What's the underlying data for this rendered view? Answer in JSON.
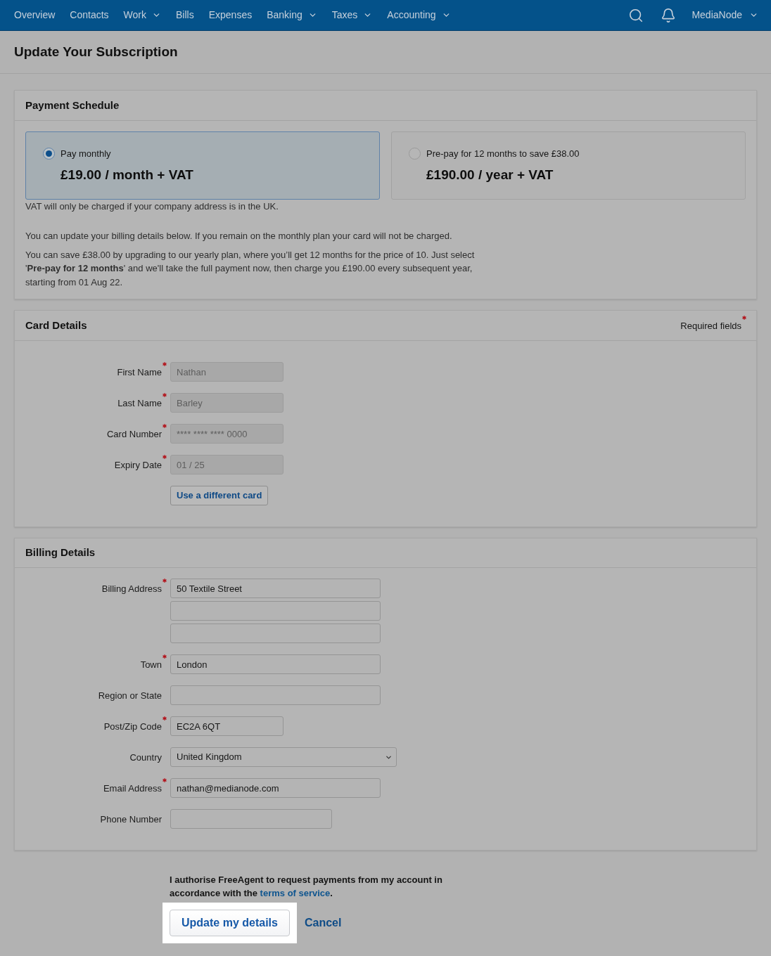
{
  "nav": {
    "items": [
      {
        "label": "Overview",
        "has_menu": false
      },
      {
        "label": "Contacts",
        "has_menu": false
      },
      {
        "label": "Work",
        "has_menu": true
      },
      {
        "label": "Bills",
        "has_menu": false
      },
      {
        "label": "Expenses",
        "has_menu": false
      },
      {
        "label": "Banking",
        "has_menu": true
      },
      {
        "label": "Taxes",
        "has_menu": true
      },
      {
        "label": "Accounting",
        "has_menu": true
      }
    ],
    "account": {
      "label": "MediaNode",
      "has_menu": true
    }
  },
  "page_title": "Update Your Subscription",
  "payment_schedule": {
    "title": "Payment Schedule",
    "plans": [
      {
        "label": "Pay monthly",
        "price": "£19.00 / month + VAT",
        "selected": true
      },
      {
        "label": "Pre-pay for 12 months to save £38.00",
        "price": "£190.00 / year + VAT",
        "selected": false
      }
    ],
    "vat_note": "VAT will only be charged if your company address is in the UK.",
    "paragraphs": [
      "You can update your billing details below. If you remain on the monthly plan your card will not be charged.",
      "You can save £38.00 by upgrading to our yearly plan, where you’ll get 12 months for the price of 10. Just select '**Pre-pay for 12 months**' and we'll take the full payment now, then charge you £190.00 every subsequent year, starting from 01 Aug 22."
    ]
  },
  "card_details": {
    "title": "Card Details",
    "required_note": "Required fields",
    "fields": [
      {
        "label": "First Name",
        "value": "Nathan",
        "required": true,
        "disabled": true
      },
      {
        "label": "Last Name",
        "value": "Barley",
        "required": true,
        "disabled": true
      },
      {
        "label": "Card Number",
        "value": "**** **** **** 0000",
        "required": true,
        "disabled": true
      },
      {
        "label": "Expiry Date",
        "value": "01 / 25",
        "required": true,
        "disabled": true
      }
    ],
    "button": "Use a different card"
  },
  "billing_details": {
    "title": "Billing Details",
    "fields": [
      {
        "kind": "text",
        "label": "Billing Address",
        "required": true,
        "value": "50 Textile Street"
      },
      {
        "kind": "continuation"
      },
      {
        "kind": "continuation"
      },
      {
        "kind": "text",
        "label": "Town",
        "required": true,
        "value": "London"
      },
      {
        "kind": "text",
        "label": "Region or State",
        "required": false
      },
      {
        "kind": "postcode",
        "label": "Post/Zip Code",
        "required": true,
        "value": "EC2A 6QT"
      },
      {
        "kind": "select",
        "label": "Country",
        "required": false,
        "value": "United Kingdom"
      },
      {
        "kind": "email",
        "label": "Email Address",
        "required": true,
        "value": "nathan@medianode.com"
      },
      {
        "kind": "phone",
        "label": "Phone Number",
        "required": false
      }
    ]
  },
  "authorisation": {
    "text": "I authorise FreeAgent to request payments from my account in accordance with the",
    "link": "terms of service",
    "end": "."
  },
  "actions": {
    "submit": {
      "label": "Update my details",
      "highlighted": true
    },
    "cancel": {
      "label": "Cancel"
    }
  }
}
